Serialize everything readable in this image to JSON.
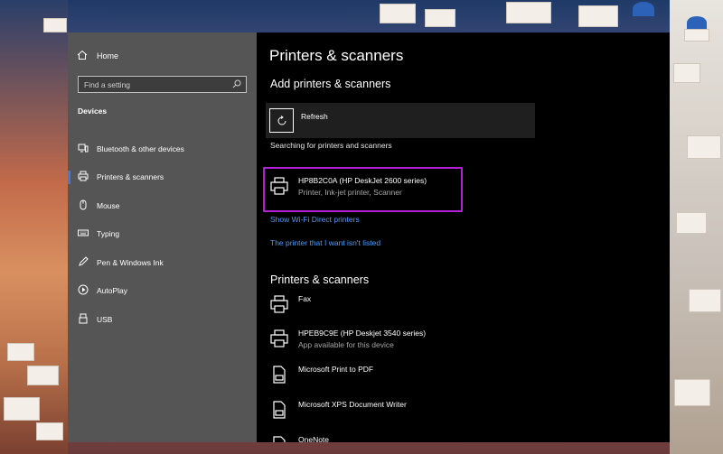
{
  "sidebar": {
    "home_label": "Home",
    "search_placeholder": "Find a setting",
    "section_label": "Devices",
    "items": [
      {
        "label": "Bluetooth & other devices",
        "icon": "bluetooth-devices-icon",
        "active": false
      },
      {
        "label": "Printers & scanners",
        "icon": "printer-icon",
        "active": true
      },
      {
        "label": "Mouse",
        "icon": "mouse-icon",
        "active": false
      },
      {
        "label": "Typing",
        "icon": "keyboard-icon",
        "active": false
      },
      {
        "label": "Pen & Windows Ink",
        "icon": "pen-icon",
        "active": false
      },
      {
        "label": "AutoPlay",
        "icon": "autoplay-icon",
        "active": false
      },
      {
        "label": "USB",
        "icon": "usb-icon",
        "active": false
      }
    ]
  },
  "main": {
    "title": "Printers & scanners",
    "add_heading": "Add printers & scanners",
    "refresh_label": "Refresh",
    "searching_text": "Searching for printers and scanners",
    "found_device": {
      "name": "HP8B2C0A (HP DeskJet 2600 series)",
      "subtitle": "Printer, Ink-jet printer, Scanner"
    },
    "links": {
      "wifi_direct": "Show Wi-Fi Direct printers",
      "not_listed": "The printer that I want isn't listed"
    },
    "list_heading": "Printers & scanners",
    "devices": [
      {
        "name": "Fax",
        "subtitle": "",
        "icon": "printer-icon"
      },
      {
        "name": "HPEB9C9E (HP Deskjet 3540 series)",
        "subtitle": "App available for this device",
        "icon": "printer-icon"
      },
      {
        "name": "Microsoft Print to PDF",
        "subtitle": "",
        "icon": "document-printer-icon"
      },
      {
        "name": "Microsoft XPS Document Writer",
        "subtitle": "",
        "icon": "document-printer-icon"
      },
      {
        "name": "OneNote",
        "subtitle": "",
        "icon": "document-printer-icon"
      }
    ]
  },
  "colors": {
    "accent": "#3b7ddd",
    "link": "#4c9bff",
    "highlight": "#b21fd6",
    "sidebar_bg": "#555555"
  }
}
